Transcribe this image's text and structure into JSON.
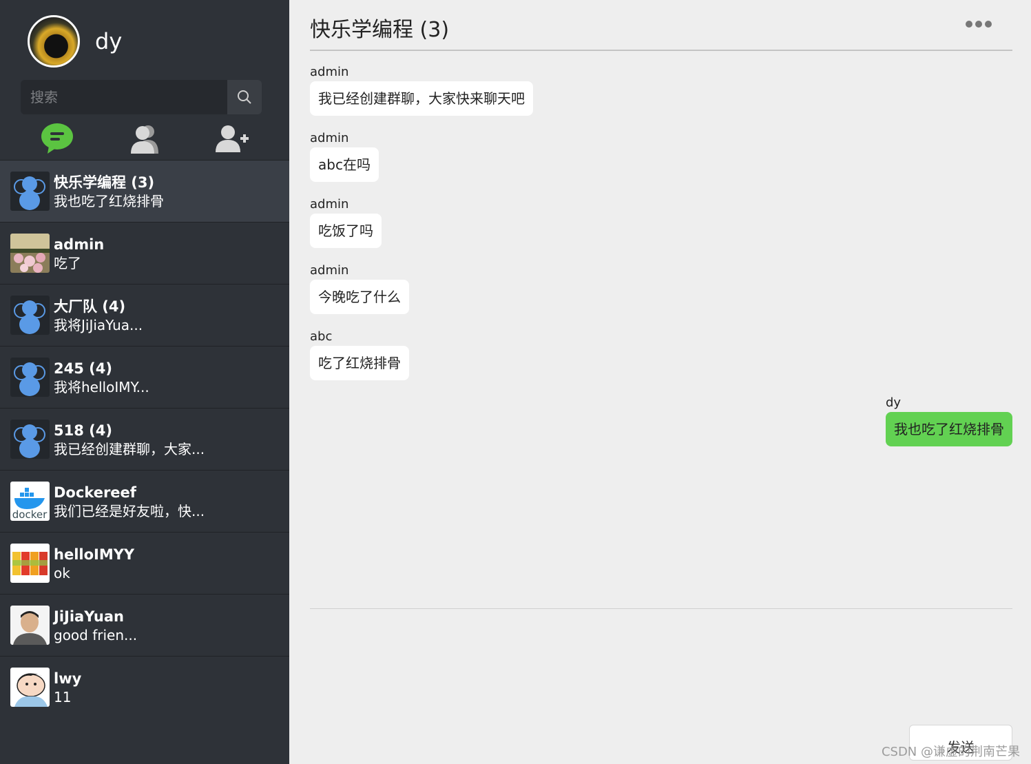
{
  "profile": {
    "name": "dy"
  },
  "search": {
    "placeholder": "搜索"
  },
  "tabs": [
    {
      "icon": "chat-bubble-icon",
      "color": "#5bc441"
    },
    {
      "icon": "contacts-icon",
      "color": "#d8d8d8"
    },
    {
      "icon": "add-user-icon",
      "color": "#d8d8d8"
    }
  ],
  "chats": [
    {
      "name": "快乐学编程 (3)",
      "last": "我也吃了红烧排骨",
      "avatar": "group-icon",
      "active": true
    },
    {
      "name": "admin",
      "last": "吃了",
      "avatar": "flowers-photo"
    },
    {
      "name": "大厂队 (4)",
      "last": "我将JiJiaYua...",
      "avatar": "group-icon"
    },
    {
      "name": "245 (4)",
      "last": "我将helloIMY...",
      "avatar": "group-icon"
    },
    {
      "name": "518 (4)",
      "last": "我已经创建群聊，大家...",
      "avatar": "group-icon"
    },
    {
      "name": "Dockereef",
      "last": "我们已经是好友啦，快...",
      "avatar": "docker-logo",
      "logo_text": "docker"
    },
    {
      "name": "helloIMYY",
      "last": "ok",
      "avatar": "snacks-photo"
    },
    {
      "name": "JiJiaYuan",
      "last": "good frien...",
      "avatar": "person-photo"
    },
    {
      "name": "lwy",
      "last": "11",
      "avatar": "cartoon-avatar"
    }
  ],
  "room": {
    "title": "快乐学编程 (3)"
  },
  "messages": [
    {
      "sender": "admin",
      "text": "我已经创建群聊，大家快来聊天吧",
      "mine": false
    },
    {
      "sender": "admin",
      "text": "abc在吗",
      "mine": false
    },
    {
      "sender": "admin",
      "text": "吃饭了吗",
      "mine": false
    },
    {
      "sender": "admin",
      "text": "今晚吃了什么",
      "mine": false
    },
    {
      "sender": "abc",
      "text": "吃了红烧排骨",
      "mine": false
    },
    {
      "sender": "dy",
      "text": "我也吃了红烧排骨",
      "mine": true
    }
  ],
  "composer": {
    "send_label": "发送"
  },
  "watermark": "CSDN @谦虚的荆南芒果",
  "colors": {
    "sidebar": "#2e3238",
    "accent": "#62d152",
    "group_avatar": "#5a9ae6"
  }
}
